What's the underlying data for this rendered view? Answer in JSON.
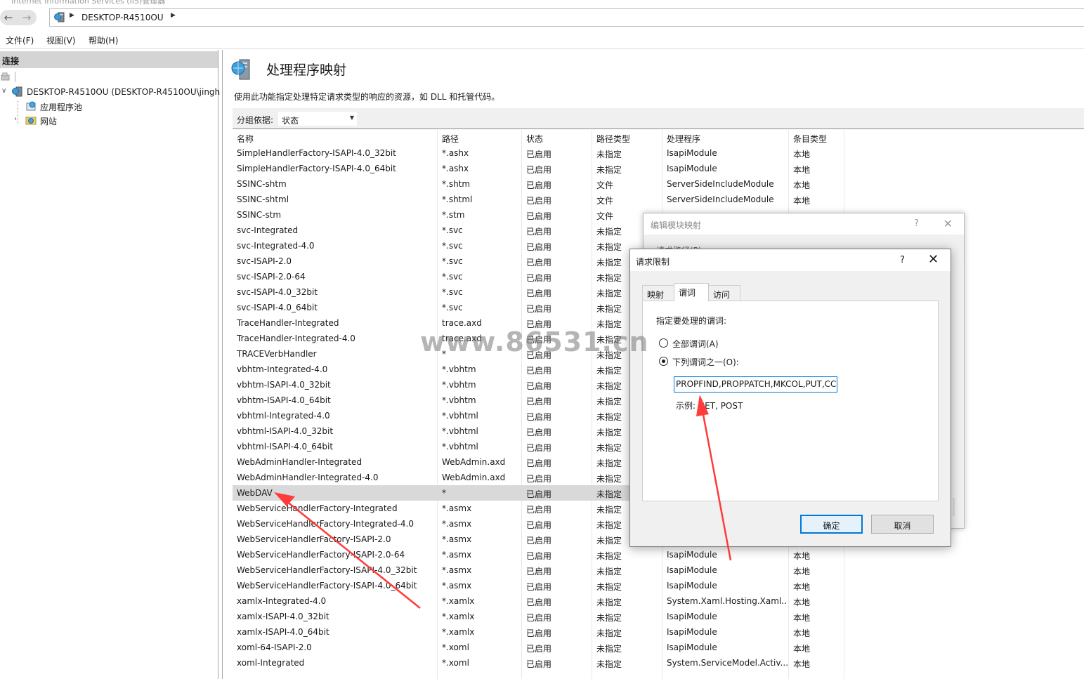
{
  "window": {
    "title": "Internet Information Services (IIS)管理器"
  },
  "address": {
    "server": "DESKTOP-R4510OU"
  },
  "menu": {
    "file": "文件(F)",
    "view": "视图(V)",
    "help": "帮助(H)"
  },
  "connections": {
    "header": "连接",
    "server_node": "DESKTOP-R4510OU (DESKTOP-R4510OU\\jingh",
    "app_pools": "应用程序池",
    "sites": "网站"
  },
  "page": {
    "title": "处理程序映射",
    "description": "使用此功能指定处理特定请求类型的响应的资源，如 DLL 和托管代码。",
    "group_by_label": "分组依据:",
    "group_by_value": "状态"
  },
  "columns": [
    "名称",
    "路径",
    "状态",
    "路径类型",
    "处理程序",
    "条目类型"
  ],
  "rows": [
    [
      "SimpleHandlerFactory-ISAPI-4.0_32bit",
      "*.ashx",
      "已启用",
      "未指定",
      "IsapiModule",
      "本地"
    ],
    [
      "SimpleHandlerFactory-ISAPI-4.0_64bit",
      "*.ashx",
      "已启用",
      "未指定",
      "IsapiModule",
      "本地"
    ],
    [
      "SSINC-shtm",
      "*.shtm",
      "已启用",
      "文件",
      "ServerSideIncludeModule",
      "本地"
    ],
    [
      "SSINC-shtml",
      "*.shtml",
      "已启用",
      "文件",
      "ServerSideIncludeModule",
      "本地"
    ],
    [
      "SSINC-stm",
      "*.stm",
      "已启用",
      "文件",
      "",
      ""
    ],
    [
      "svc-Integrated",
      "*.svc",
      "已启用",
      "未指定",
      "",
      ""
    ],
    [
      "svc-Integrated-4.0",
      "*.svc",
      "已启用",
      "未指定",
      "",
      ""
    ],
    [
      "svc-ISAPI-2.0",
      "*.svc",
      "已启用",
      "未指定",
      "",
      ""
    ],
    [
      "svc-ISAPI-2.0-64",
      "*.svc",
      "已启用",
      "未指定",
      "",
      ""
    ],
    [
      "svc-ISAPI-4.0_32bit",
      "*.svc",
      "已启用",
      "未指定",
      "",
      ""
    ],
    [
      "svc-ISAPI-4.0_64bit",
      "*.svc",
      "已启用",
      "未指定",
      "",
      ""
    ],
    [
      "TraceHandler-Integrated",
      "trace.axd",
      "已启用",
      "未指定",
      "",
      ""
    ],
    [
      "TraceHandler-Integrated-4.0",
      "trace.axd",
      "已启用",
      "未指定",
      "",
      ""
    ],
    [
      "TRACEVerbHandler",
      "*",
      "已启用",
      "未指定",
      "",
      ""
    ],
    [
      "vbhtm-Integrated-4.0",
      "*.vbhtm",
      "已启用",
      "未指定",
      "",
      ""
    ],
    [
      "vbhtm-ISAPI-4.0_32bit",
      "*.vbhtm",
      "已启用",
      "未指定",
      "",
      ""
    ],
    [
      "vbhtm-ISAPI-4.0_64bit",
      "*.vbhtm",
      "已启用",
      "未指定",
      "",
      ""
    ],
    [
      "vbhtml-Integrated-4.0",
      "*.vbhtml",
      "已启用",
      "未指定",
      "",
      ""
    ],
    [
      "vbhtml-ISAPI-4.0_32bit",
      "*.vbhtml",
      "已启用",
      "未指定",
      "",
      ""
    ],
    [
      "vbhtml-ISAPI-4.0_64bit",
      "*.vbhtml",
      "已启用",
      "未指定",
      "",
      ""
    ],
    [
      "WebAdminHandler-Integrated",
      "WebAdmin.axd",
      "已启用",
      "未指定",
      "",
      ""
    ],
    [
      "WebAdminHandler-Integrated-4.0",
      "WebAdmin.axd",
      "已启用",
      "未指定",
      "",
      ""
    ],
    [
      "WebDAV",
      "*",
      "已启用",
      "未指定",
      "",
      ""
    ],
    [
      "WebServiceHandlerFactory-Integrated",
      "*.asmx",
      "已启用",
      "未指定",
      "",
      ""
    ],
    [
      "WebServiceHandlerFactory-Integrated-4.0",
      "*.asmx",
      "已启用",
      "未指定",
      "",
      ""
    ],
    [
      "WebServiceHandlerFactory-ISAPI-2.0",
      "*.asmx",
      "已启用",
      "未指定",
      "",
      ""
    ],
    [
      "WebServiceHandlerFactory-ISAPI-2.0-64",
      "*.asmx",
      "已启用",
      "未指定",
      "IsapiModule",
      "本地"
    ],
    [
      "WebServiceHandlerFactory-ISAPI-4.0_32bit",
      "*.asmx",
      "已启用",
      "未指定",
      "IsapiModule",
      "本地"
    ],
    [
      "WebServiceHandlerFactory-ISAPI-4.0_64bit",
      "*.asmx",
      "已启用",
      "未指定",
      "IsapiModule",
      "本地"
    ],
    [
      "xamlx-Integrated-4.0",
      "*.xamlx",
      "已启用",
      "未指定",
      "System.Xaml.Hosting.Xaml...",
      "本地"
    ],
    [
      "xamlx-ISAPI-4.0_32bit",
      "*.xamlx",
      "已启用",
      "未指定",
      "IsapiModule",
      "本地"
    ],
    [
      "xamlx-ISAPI-4.0_64bit",
      "*.xamlx",
      "已启用",
      "未指定",
      "IsapiModule",
      "本地"
    ],
    [
      "xoml-64-ISAPI-2.0",
      "*.xoml",
      "已启用",
      "未指定",
      "IsapiModule",
      "本地"
    ],
    [
      "xoml-Integrated",
      "*.xoml",
      "已启用",
      "未指定",
      "System.ServiceModel.Activ...",
      "本地"
    ]
  ],
  "selected_row": "WebDAV",
  "back_dialog": {
    "title": "编辑模块映射",
    "help": "?",
    "close": "✕",
    "partial_label": "请求路径(P):"
  },
  "dialog": {
    "title": "请求限制",
    "help": "?",
    "close": "✕",
    "tabs": [
      "映射",
      "谓词",
      "访问"
    ],
    "active_tab": "谓词",
    "prompt": "指定要处理的谓词:",
    "all_verbs_label": "全部谓词(A)",
    "one_of_label": "下列谓词之一(O):",
    "one_of_selected": true,
    "verbs_value": "PROPFIND,PROPPATCH,MKCOL,PUT,CC",
    "example": "示例: GET, POST",
    "ok": "确定",
    "cancel": "取消"
  },
  "watermark": "www.86531.cn",
  "colors": {
    "accent": "#0078d7",
    "arrow": "#ff3b3b",
    "selected_row": "#d9d9d9",
    "pane_header": "#d4d4d4"
  }
}
